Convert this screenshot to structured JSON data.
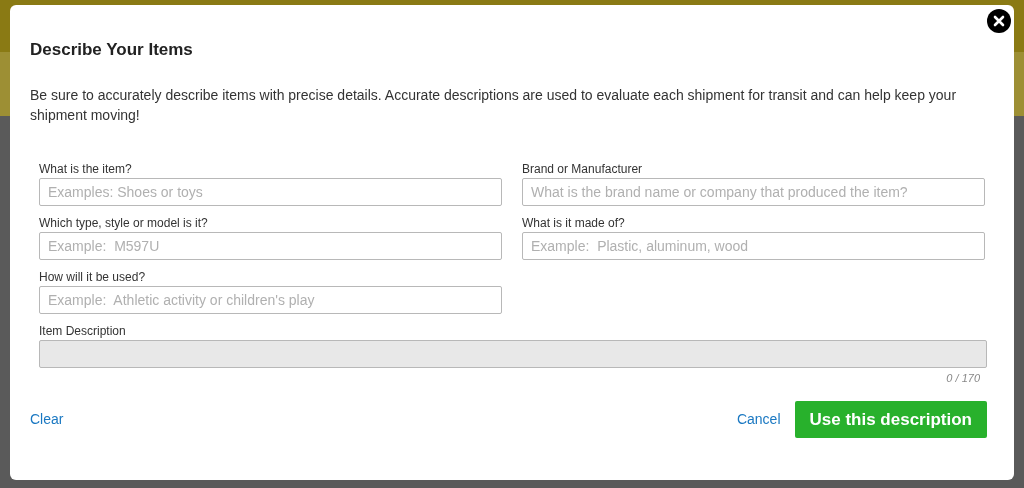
{
  "dialog": {
    "title": "Describe Your Items",
    "intro": "Be sure to accurately describe items with precise details. Accurate descriptions are used to evaluate each shipment for transit and can help keep your shipment moving!",
    "fields": [
      {
        "label": "What is the item?",
        "placeholder": "Examples: Shoes or toys"
      },
      {
        "label": "Brand or Manufacturer",
        "placeholder": "What is the brand name or company that produced the item?"
      },
      {
        "label": "Which type, style or model is it?",
        "placeholder": "Example:  M597U"
      },
      {
        "label": "What is it made of?",
        "placeholder": "Example:  Plastic, aluminum, wood"
      },
      {
        "label": "How will it be used?",
        "placeholder": "Example:  Athletic activity or children's play"
      }
    ],
    "description": {
      "label": "Item Description",
      "disabled": true,
      "counter": "0 / 170"
    },
    "clear": "Clear",
    "cancel": "Cancel",
    "submit": "Use this description"
  }
}
